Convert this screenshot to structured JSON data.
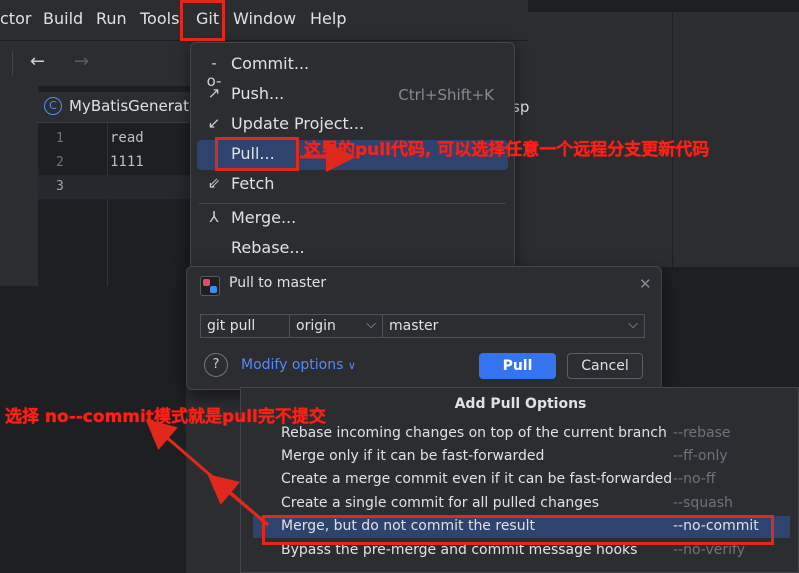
{
  "menubar": {
    "items": [
      {
        "label": "ctor"
      },
      {
        "label": "Build"
      },
      {
        "label": "Run"
      },
      {
        "label": "Tools"
      },
      {
        "label": "Git"
      },
      {
        "label": "Window"
      },
      {
        "label": "Help"
      }
    ]
  },
  "toolbar": {
    "back_icon": "arrow-left-icon",
    "forward_icon": "arrow-right-icon"
  },
  "editor": {
    "tab_label": "MyBatisGenerator",
    "tab_suffix": "sp",
    "line_numbers": [
      "1",
      "2",
      "3"
    ],
    "lines": [
      "read",
      "1111",
      ""
    ]
  },
  "git_menu": {
    "items": [
      {
        "icon": "commit-icon",
        "label": "Commit...",
        "shortcut": ""
      },
      {
        "icon": "push-icon",
        "label": "Push...",
        "shortcut": "Ctrl+Shift+K"
      },
      {
        "icon": "update-icon",
        "label": "Update Project...",
        "shortcut": ""
      },
      {
        "icon": "",
        "label": "Pull...",
        "shortcut": ""
      },
      {
        "icon": "fetch-icon",
        "label": "Fetch",
        "shortcut": ""
      },
      {
        "icon": "merge-icon",
        "label": "Merge...",
        "shortcut": ""
      },
      {
        "icon": "",
        "label": "Rebase...",
        "shortcut": ""
      }
    ]
  },
  "pull_dialog": {
    "title": "Pull to master",
    "command": "git pull",
    "remote": "origin",
    "branch": "master",
    "help": "?",
    "modify_options": "Modify options",
    "pull_button": "Pull",
    "cancel_button": "Cancel"
  },
  "pull_options": {
    "title": "Add Pull Options",
    "options": [
      {
        "desc": "Rebase incoming changes on top of the current branch",
        "flag": "--rebase"
      },
      {
        "desc": "Merge only if it can be fast-forwarded",
        "flag": "--ff-only"
      },
      {
        "desc": "Create a merge commit even if it can be fast-forwarded",
        "flag": "--no-ff"
      },
      {
        "desc": "Create a single commit for all pulled changes",
        "flag": "--squash"
      },
      {
        "desc": "Merge, but do not commit the result",
        "flag": "--no-commit"
      },
      {
        "desc": "Bypass the pre-merge and commit message hooks",
        "flag": "--no-verify"
      }
    ]
  },
  "annotations": {
    "pull_note": "这里的pull代码, 可以选择任意一个远程分支更新代码",
    "nocommit_note": "选择 no--commit模式就是pull完不提交"
  },
  "colors": {
    "accent": "#3574f0",
    "selection": "#2e436e",
    "annotation": "#e0281c"
  }
}
